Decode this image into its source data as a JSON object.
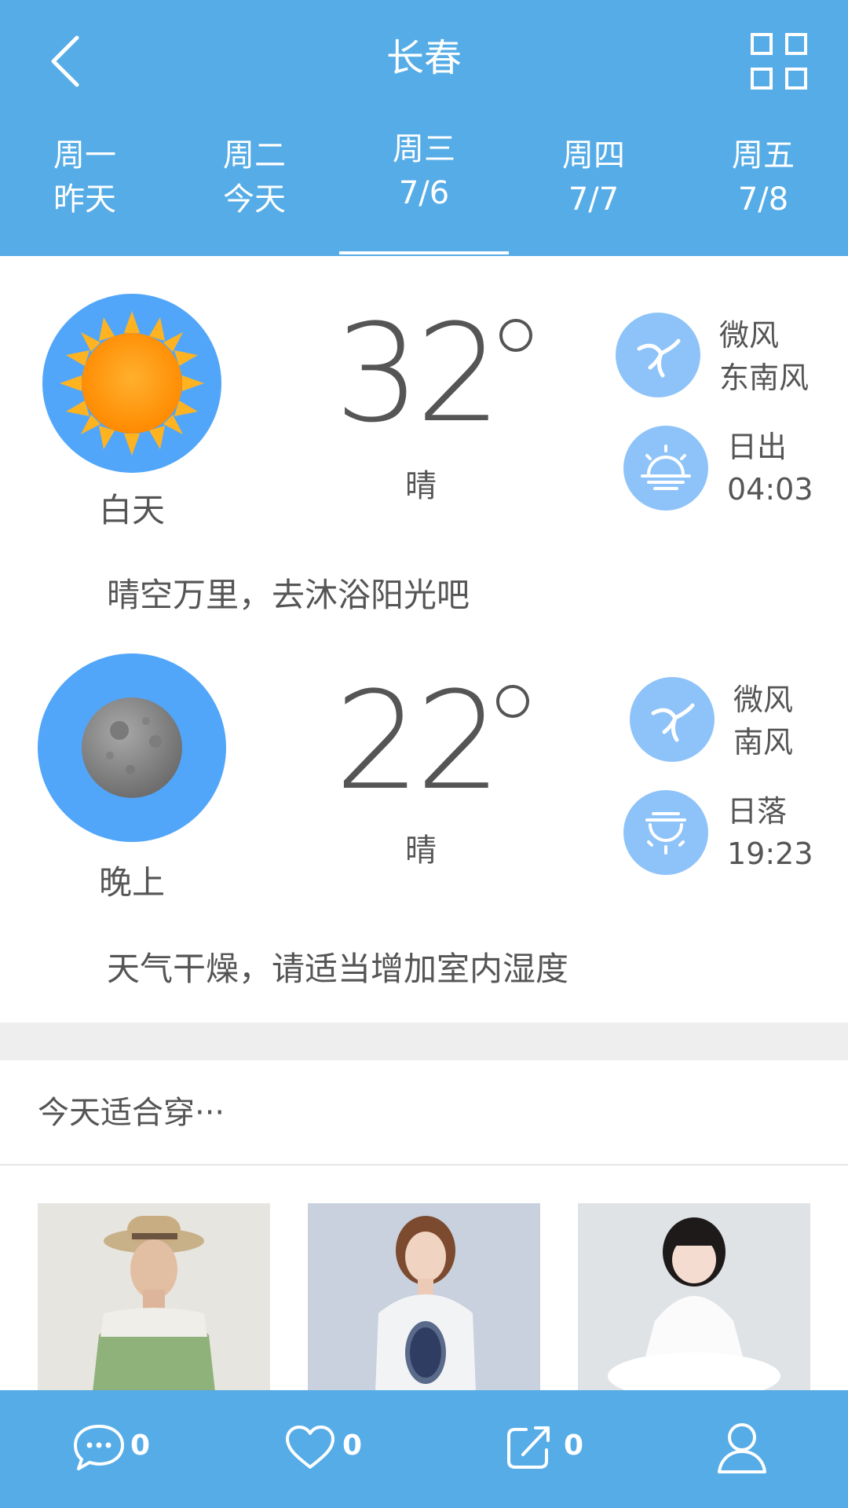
{
  "header": {
    "city": "长春",
    "tabs": [
      {
        "day": "周一",
        "date": "昨天"
      },
      {
        "day": "周二",
        "date": "今天"
      },
      {
        "day": "周三",
        "date": "7/6"
      },
      {
        "day": "周四",
        "date": "7/7"
      },
      {
        "day": "周五",
        "date": "7/8"
      }
    ],
    "active_tab_index": 2
  },
  "day": {
    "period": "白天",
    "temperature": "32",
    "condition": "晴",
    "wind_strength": "微风",
    "wind_direction": "东南风",
    "sun_label": "日出",
    "sun_time": "04:03",
    "tip": "晴空万里，去沐浴阳光吧"
  },
  "night": {
    "period": "晚上",
    "temperature": "22",
    "condition": "晴",
    "wind_strength": "微风",
    "wind_direction": "南风",
    "sun_label": "日落",
    "sun_time": "19:23",
    "tip": "天气干燥，请适当增加室内湿度"
  },
  "clothing": {
    "title": "今天适合穿···",
    "items": [
      "man-green-tshirt-photo",
      "woman-white-dress-photo",
      "girl-white-dress-photo"
    ]
  },
  "bottom_bar": {
    "comments": "0",
    "likes": "0",
    "shares": "0"
  },
  "colors": {
    "header_blue": "#56ace6",
    "circle_blue": "#52a6f9",
    "small_circle_blue": "#8ec3f9",
    "sun_orange": "#ff9b0c"
  },
  "icons": [
    "back-arrow-icon",
    "grid-icon",
    "sun-icon",
    "moon-icon",
    "wind-icon",
    "sunrise-icon",
    "sunset-icon",
    "comment-icon",
    "heart-icon",
    "share-icon",
    "user-icon"
  ]
}
